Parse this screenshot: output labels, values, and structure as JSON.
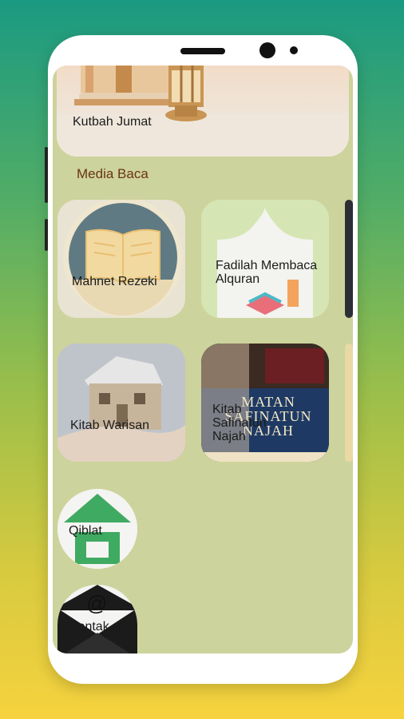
{
  "banner": {
    "label": "Kutbah Jumat"
  },
  "section": {
    "title": "Media Baca"
  },
  "cards": [
    {
      "label": "Mahnet Rezeki",
      "icon": "open-book-icon"
    },
    {
      "label": "Fadilah Membaca Alquran",
      "icon": "quran-icon"
    },
    {
      "label": "Kitab Warisan",
      "icon": "house-in-hands-icon"
    },
    {
      "label": "Kitab Safinatun Najah",
      "icon": "book-cover-icon",
      "cover_title": "MATAN SAFINATUN NAJAH"
    }
  ],
  "small_cards": [
    {
      "label": "Qiblat",
      "icon": "qibla-icon"
    },
    {
      "label": "Contak",
      "icon": "envelope-icon",
      "glyph": "@"
    }
  ],
  "colors": {
    "screen_bg": "#cdd39c",
    "section_title": "#6a3414",
    "qibla_green": "#3faa62"
  }
}
